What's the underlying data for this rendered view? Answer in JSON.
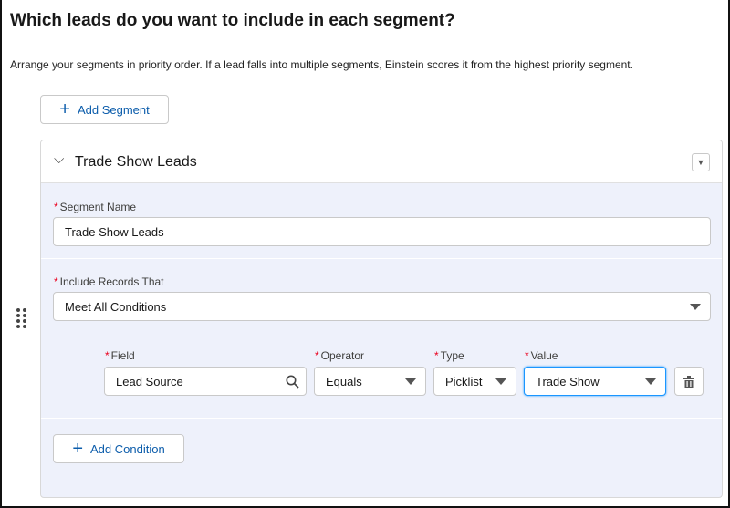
{
  "header": {
    "title": "Which leads do you want to include in each segment?",
    "subtitle": "Arrange your segments in priority order. If a lead falls into multiple segments, Einstein scores it from the highest priority segment."
  },
  "add_segment_label": "Add Segment",
  "segment": {
    "title": "Trade Show Leads",
    "name_label": "Segment Name",
    "name_value": "Trade Show Leads",
    "include_label": "Include Records That",
    "include_value": "Meet All Conditions",
    "condition": {
      "field_label": "Field",
      "field_value": "Lead Source",
      "operator_label": "Operator",
      "operator_value": "Equals",
      "type_label": "Type",
      "type_value": "Picklist",
      "value_label": "Value",
      "value_value": "Trade Show"
    },
    "add_condition_label": "Add Condition"
  },
  "required_marker": "*",
  "colors": {
    "accent": "#0b5cab",
    "required": "#ea001e",
    "panel": "#eef1fb",
    "focus": "#1b96ff"
  }
}
